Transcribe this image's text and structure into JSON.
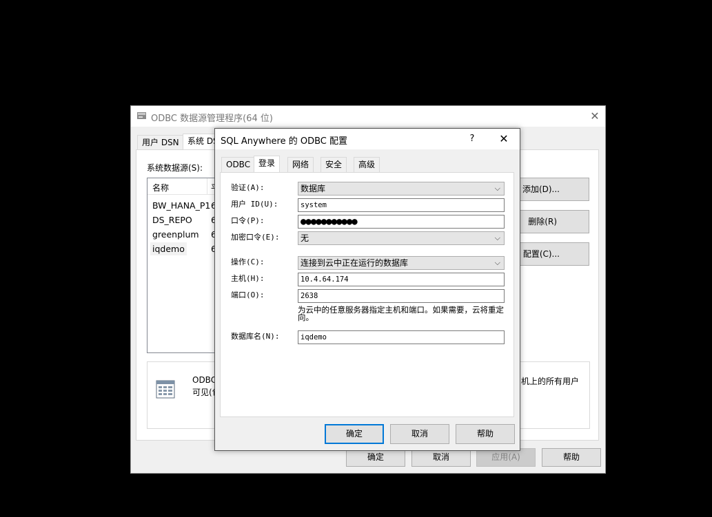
{
  "back_window": {
    "title": "ODBC 数据源管理程序(64 位)",
    "close_glyph": "✕",
    "tabs": [
      "用户 DSN",
      "系统 DS"
    ],
    "system_ds_label": "系统数据源(S):",
    "list_headers": [
      "名称",
      "平"
    ],
    "rows": [
      {
        "name": "BW_HANA_P1",
        "ver": "6"
      },
      {
        "name": "DS_REPO",
        "ver": "6"
      },
      {
        "name": "greenplum",
        "ver": "6"
      },
      {
        "name": "iqdemo",
        "ver": "6"
      }
    ],
    "side_buttons": [
      "添加(D)...",
      "删除(R)",
      "配置(C)..."
    ],
    "info_text_1": "ODBC",
    "info_text_2": "可见(包",
    "info_text_3": "机上的所有用户",
    "bottom_buttons": {
      "ok": "确定",
      "cancel": "取消",
      "apply": "应用(A)",
      "help": "帮助"
    }
  },
  "dialog": {
    "title": "SQL Anywhere 的 ODBC 配置",
    "help_glyph": "?",
    "close_glyph": "✕",
    "tabs": [
      "ODBC",
      "登录",
      "网络",
      "安全",
      "高级"
    ],
    "active_tab": "登录",
    "fields": {
      "auth_label": "验证(A):",
      "auth_value": "数据库",
      "userid_label": "用户 ID(U):",
      "userid_value": "system",
      "password_label": "口令(P):",
      "password_value": "●●●●●●●●●●●",
      "encpwd_label": "加密口令(E):",
      "encpwd_value": "无",
      "action_label": "操作(C):",
      "action_value": "连接到云中正在运行的数据库",
      "host_label": "主机(H):",
      "host_value": "10.4.64.174",
      "port_label": "端口(O):",
      "port_value": "2638",
      "hint": "为云中的任意服务器指定主机和端口。如果需要，云将重定向。",
      "dbname_label": "数据库名(N):",
      "dbname_value": "iqdemo"
    },
    "buttons": {
      "ok": "确定",
      "cancel": "取消",
      "help": "帮助"
    },
    "colors": {
      "default_button_border": "#0078d7"
    }
  }
}
